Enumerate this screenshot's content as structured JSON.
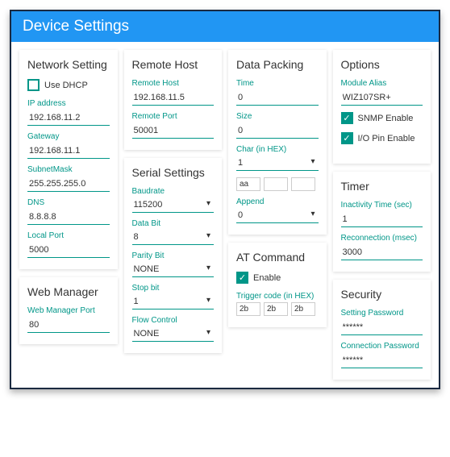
{
  "header": {
    "title": "Device Settings"
  },
  "network": {
    "title": "Network Setting",
    "dhcp_label": "Use DHCP",
    "ip_label": "IP address",
    "ip_value": "192.168.11.2",
    "gw_label": "Gateway",
    "gw_value": "192.168.11.1",
    "sm_label": "SubnetMask",
    "sm_value": "255.255.255.0",
    "dns_label": "DNS",
    "dns_value": "8.8.8.8",
    "lp_label": "Local Port",
    "lp_value": "5000"
  },
  "webmgr": {
    "title": "Web Manager",
    "port_label": "Web Manager Port",
    "port_value": "80"
  },
  "remote": {
    "title": "Remote Host",
    "host_label": "Remote Host",
    "host_value": "192.168.11.5",
    "port_label": "Remote Port",
    "port_value": "50001"
  },
  "serial": {
    "title": "Serial Settings",
    "baud_label": "Baudrate",
    "baud_value": "115200",
    "db_label": "Data Bit",
    "db_value": "8",
    "pb_label": "Parity Bit",
    "pb_value": "NONE",
    "sb_label": "Stop bit",
    "sb_value": "1",
    "fc_label": "Flow Control",
    "fc_value": "NONE"
  },
  "packing": {
    "title": "Data Packing",
    "time_label": "Time",
    "time_value": "0",
    "size_label": "Size",
    "size_value": "0",
    "char_label": "Char (in HEX)",
    "char_value": "1",
    "hex1": "aa",
    "hex2": "",
    "hex3": "",
    "append_label": "Append",
    "append_value": "0"
  },
  "at": {
    "title": "AT Command",
    "enable_label": "Enable",
    "trig_label": "Trigger code (in HEX)",
    "t1": "2b",
    "t2": "2b",
    "t3": "2b"
  },
  "options": {
    "title": "Options",
    "alias_label": "Module Alias",
    "alias_value": "WIZ107SR+",
    "snmp_label": "SNMP Enable",
    "io_label": "I/O Pin Enable"
  },
  "timer": {
    "title": "Timer",
    "inact_label": "Inactivity Time (sec)",
    "inact_value": "1",
    "recon_label": "Reconnection (msec)",
    "recon_value": "3000"
  },
  "security": {
    "title": "Security",
    "sp_label": "Setting Password",
    "sp_value": "******",
    "cp_label": "Connection Password",
    "cp_value": "******"
  }
}
